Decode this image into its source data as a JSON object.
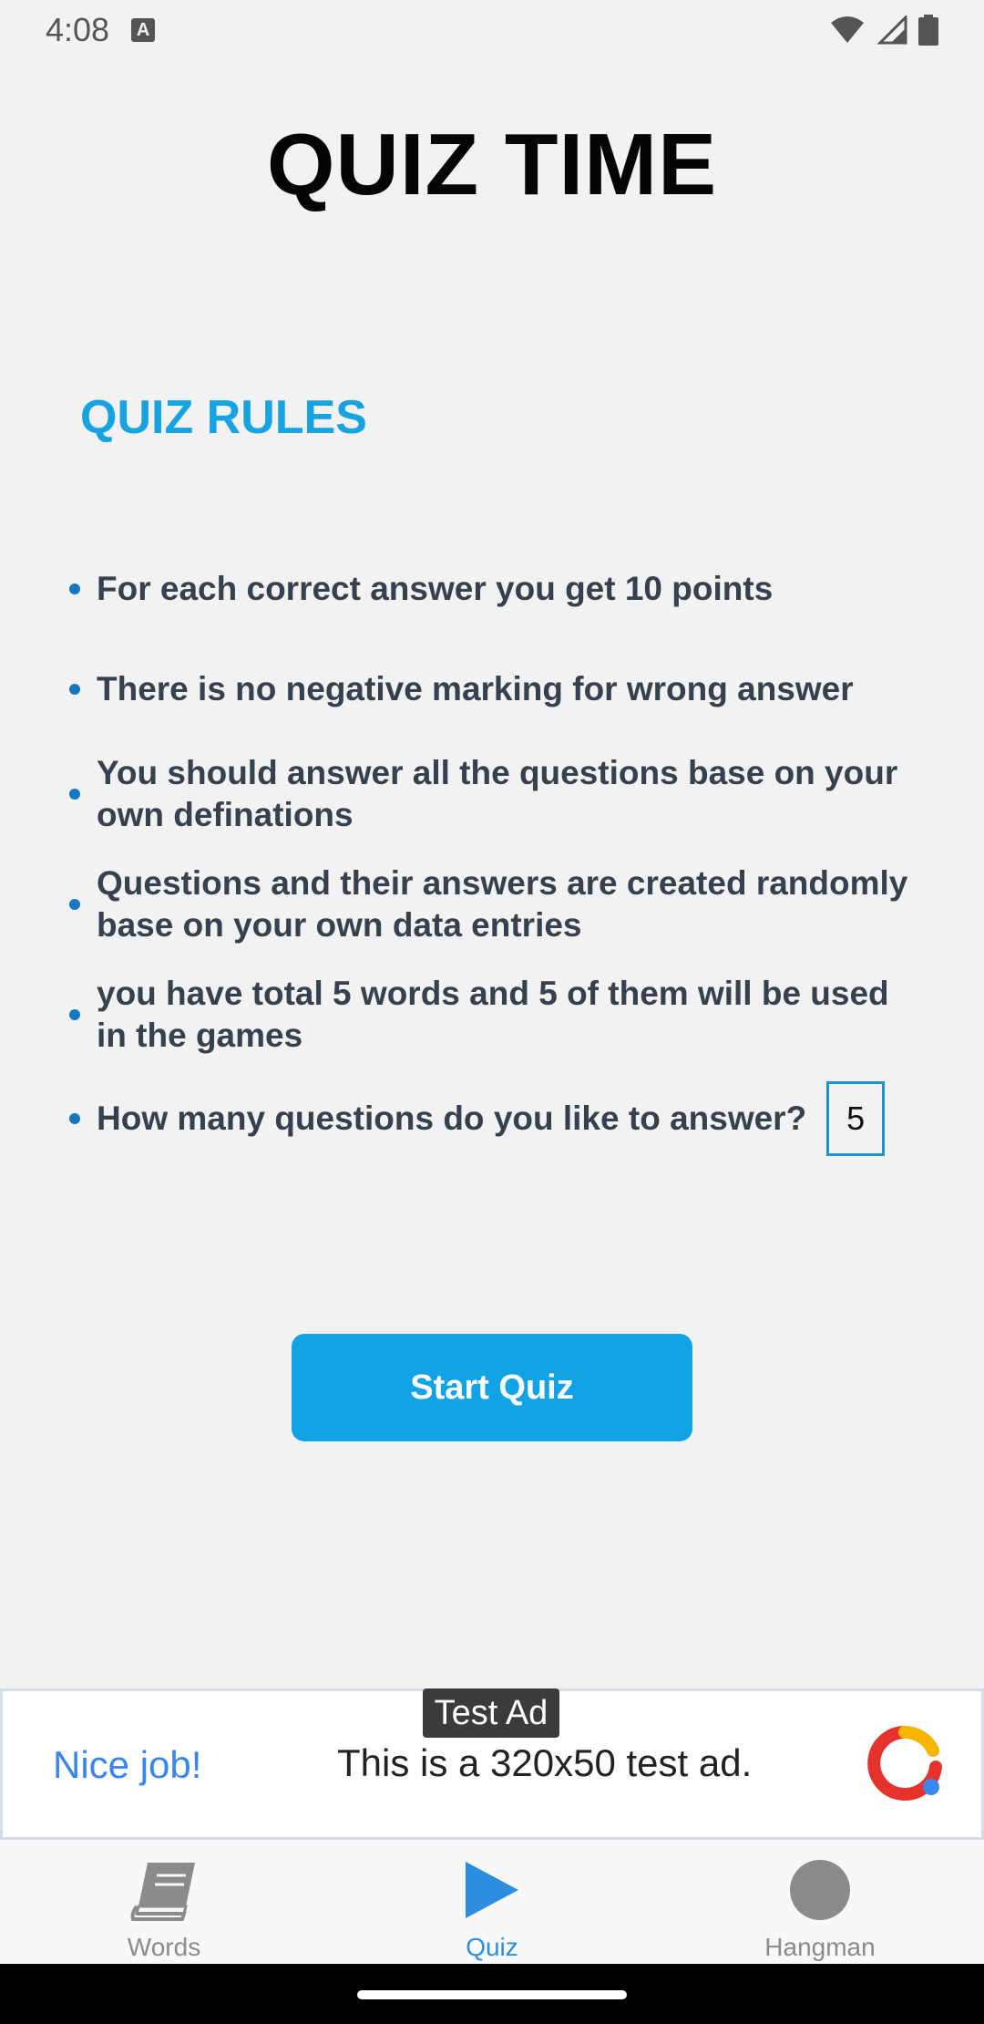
{
  "status_bar": {
    "time": "4:08",
    "notification_icon": "A"
  },
  "page": {
    "title": "QUIZ TIME",
    "rules_heading": "QUIZ RULES"
  },
  "rules": [
    "For each correct answer you get 10 points",
    "There is no negative marking for wrong answer",
    "You should answer all the questions base on your own definations",
    "Questions and their answers are created randomly base on your own data entries",
    "you have total 5 words and 5 of them will be used in the games",
    "How many questions do you like to answer?"
  ],
  "question_count": "5",
  "start_button": "Start Quiz",
  "ad": {
    "tag": "Test Ad",
    "headline": "Nice job!",
    "body": "This is a 320x50 test ad."
  },
  "bottom_nav": {
    "items": [
      {
        "label": "Words",
        "icon": "book-icon",
        "active": false
      },
      {
        "label": "Quiz",
        "icon": "play-icon",
        "active": true
      },
      {
        "label": "Hangman",
        "icon": "circle-icon",
        "active": false
      }
    ]
  },
  "colors": {
    "accent": "#12a3e6",
    "heading": "#17a3e2",
    "nav_active": "#2d8ee0"
  }
}
